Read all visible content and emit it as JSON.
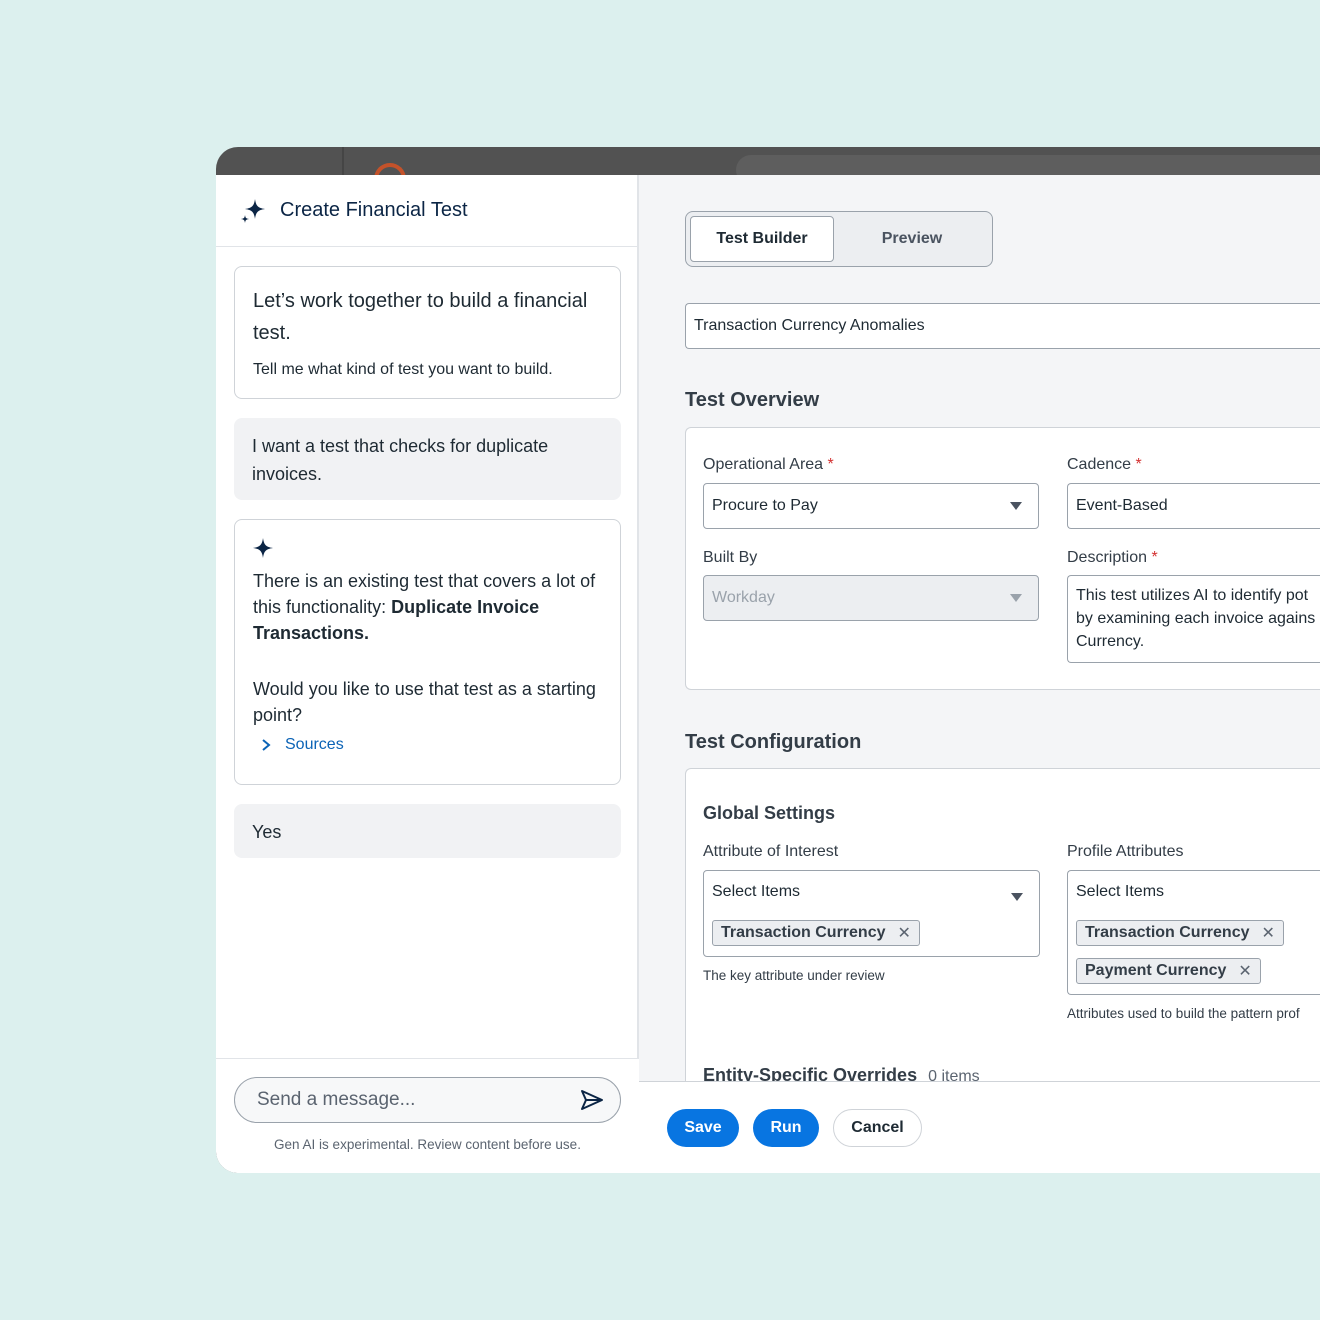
{
  "chat": {
    "title": "Create Financial Test",
    "messages": [
      {
        "role": "ai",
        "heading": "Let’s work together to build a financial test.",
        "text": "Tell me what kind of test you want to build."
      },
      {
        "role": "user",
        "text": "I want a test that checks for duplicate invoices."
      },
      {
        "role": "ai",
        "text_before": "There is an existing test that covers a lot of this functionality: ",
        "text_bold": "Duplicate Invoice Transactions.",
        "text_after": "Would you like to use that test as a starting point?",
        "sources_label": "Sources"
      },
      {
        "role": "user",
        "text": "Yes"
      }
    ],
    "composer_placeholder": "Send a message...",
    "disclaimer": "Gen AI is experimental. Review content before use."
  },
  "tabs": [
    {
      "label": "Test Builder",
      "active": true
    },
    {
      "label": "Preview",
      "active": false
    }
  ],
  "test_name": "Transaction Currency Anomalies",
  "overview": {
    "title": "Test Overview",
    "operational_area": {
      "label": "Operational Area",
      "value": "Procure to Pay"
    },
    "cadence": {
      "label": "Cadence",
      "value": "Event-Based"
    },
    "built_by": {
      "label": "Built By",
      "value": "Workday"
    },
    "description": {
      "label": "Description",
      "value": "This test utilizes AI to identify pot by examining each invoice agains Currency."
    },
    "required_mark": "*"
  },
  "configuration": {
    "title": "Test Configuration",
    "global_settings": "Global Settings",
    "attribute_of_interest": {
      "label": "Attribute of Interest",
      "placeholder": "Select Items",
      "chips": [
        "Transaction Currency"
      ],
      "helper": "The key attribute under review"
    },
    "profile_attributes": {
      "label": "Profile Attributes",
      "placeholder": "Select Items",
      "chips": [
        "Transaction Currency",
        "Payment Currency"
      ],
      "helper": "Attributes used to build the pattern prof"
    },
    "overrides": {
      "label": "Entity-Specific Overrides",
      "count": "0 items"
    }
  },
  "footer": {
    "save": "Save",
    "run": "Run",
    "cancel": "Cancel"
  },
  "colors": {
    "primary": "#0875e1",
    "navy": "#0b2545",
    "link": "#0b63b6",
    "required": "#d32f2f",
    "background": "#dcf0ee"
  },
  "icons": {
    "sparkle": "sparkle-icon",
    "send": "send-icon",
    "dropdown": "caret-down-icon",
    "remove": "close-icon",
    "expand": "chevron-right-icon"
  }
}
